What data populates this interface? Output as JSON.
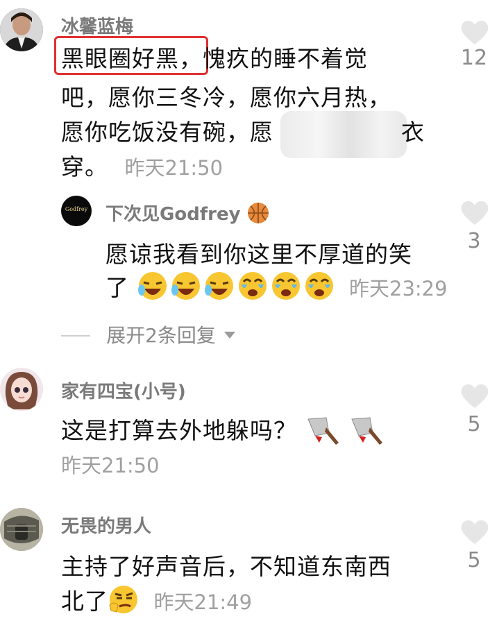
{
  "comments": [
    {
      "user": "冰馨蓝梅",
      "line1_highlight": "黑眼圈好黑，",
      "line1_rest": "愧疚的睡不着觉",
      "line2": "吧，愿你三冬冷，愿你六月热，",
      "line3": "愿你吃饭没有碗，愿",
      "line3_tail": "衣",
      "line4": "穿。",
      "time": "昨天21:50",
      "likes": "12"
    },
    {
      "user": "家有四宝(小号)",
      "line1": "这是打算去外地躲吗？",
      "time": "昨天21:50",
      "likes": "5"
    },
    {
      "user": "无畏的男人",
      "line1": "主持了好声音后，不知道东南西",
      "line2": "北了",
      "time": "昨天21:49",
      "likes": "5"
    }
  ],
  "reply": {
    "user": "下次见Godfrey",
    "avatar_text": "Godfrey",
    "line1": "愿谅我看到你这里不厚道的笑",
    "line2": "了",
    "time": "昨天23:29",
    "likes": "3"
  },
  "expand_replies": "展开2条回复",
  "colors": {
    "highlight_box": "#e03030",
    "heart": "#e6e6e6",
    "muted": "#a0a0a0"
  },
  "icons": [
    "heart-icon",
    "basketball-icon",
    "laughing-crying-emoji-icon",
    "tears-of-joy-emoji-icon",
    "cleaver-knife-icon",
    "smirk-emoji-icon",
    "chevron-down-icon"
  ]
}
